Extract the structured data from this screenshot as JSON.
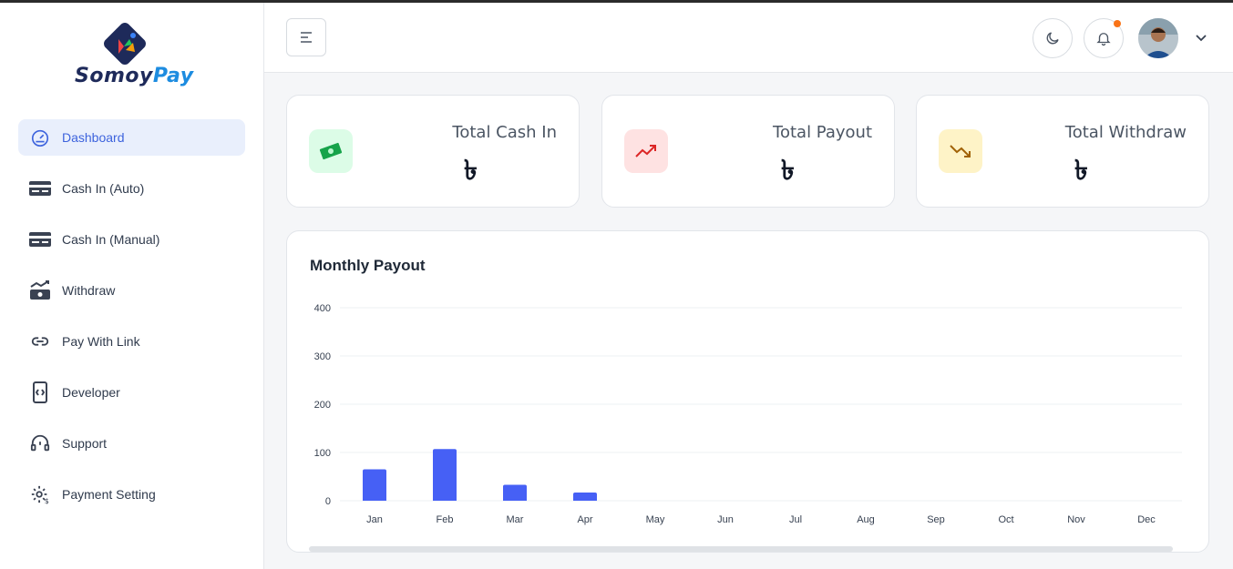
{
  "brand": {
    "name_part1": "Somoy",
    "name_part2": "Pay",
    "colors": {
      "dark": "#1e2a5a",
      "light": "#1d8ce0"
    }
  },
  "sidebar": {
    "items": [
      {
        "label": "Dashboard",
        "icon": "speedometer-icon",
        "active": true
      },
      {
        "label": "Cash In (Auto)",
        "icon": "card-icon",
        "active": false
      },
      {
        "label": "Cash In (Manual)",
        "icon": "card-icon",
        "active": false
      },
      {
        "label": "Withdraw",
        "icon": "money-trend-icon",
        "active": false
      },
      {
        "label": "Pay With Link",
        "icon": "link-icon",
        "active": false
      },
      {
        "label": "Developer",
        "icon": "code-device-icon",
        "active": false
      },
      {
        "label": "Support",
        "icon": "headset-icon",
        "active": false
      },
      {
        "label": "Payment Setting",
        "icon": "gear-money-icon",
        "active": false
      }
    ]
  },
  "header": {
    "menu_icon": "menu-icon",
    "theme_icon": "moon-icon",
    "notification_icon": "bell-icon",
    "notification_dot_color": "#f97316",
    "avatar_icon": "avatar-icon",
    "dropdown_icon": "chevron-down-icon"
  },
  "cards": [
    {
      "title": "Total Cash In",
      "value": "৳",
      "icon": "cash-icon",
      "badge_color": "#dcfce7",
      "icon_color": "#16a34a"
    },
    {
      "title": "Total Payout",
      "value": "৳",
      "icon": "trend-up-icon",
      "badge_color": "#fee2e2",
      "icon_color": "#dc2626"
    },
    {
      "title": "Total Withdraw",
      "value": "৳",
      "icon": "trend-down-icon",
      "badge_color": "#fef3c7",
      "icon_color": "#ca8a04"
    }
  ],
  "chart_data": {
    "type": "bar",
    "title": "Monthly Payout",
    "categories": [
      "Jan",
      "Feb",
      "Mar",
      "Apr",
      "May",
      "Jun",
      "Jul",
      "Aug",
      "Sep",
      "Oct",
      "Nov",
      "Dec"
    ],
    "values": [
      65,
      107,
      33,
      17,
      0,
      0,
      0,
      0,
      0,
      0,
      0,
      0
    ],
    "ylim": [
      0,
      400
    ],
    "yticks": [
      0,
      100,
      200,
      300,
      400
    ],
    "grid": true,
    "bar_color": "#4660f5"
  }
}
